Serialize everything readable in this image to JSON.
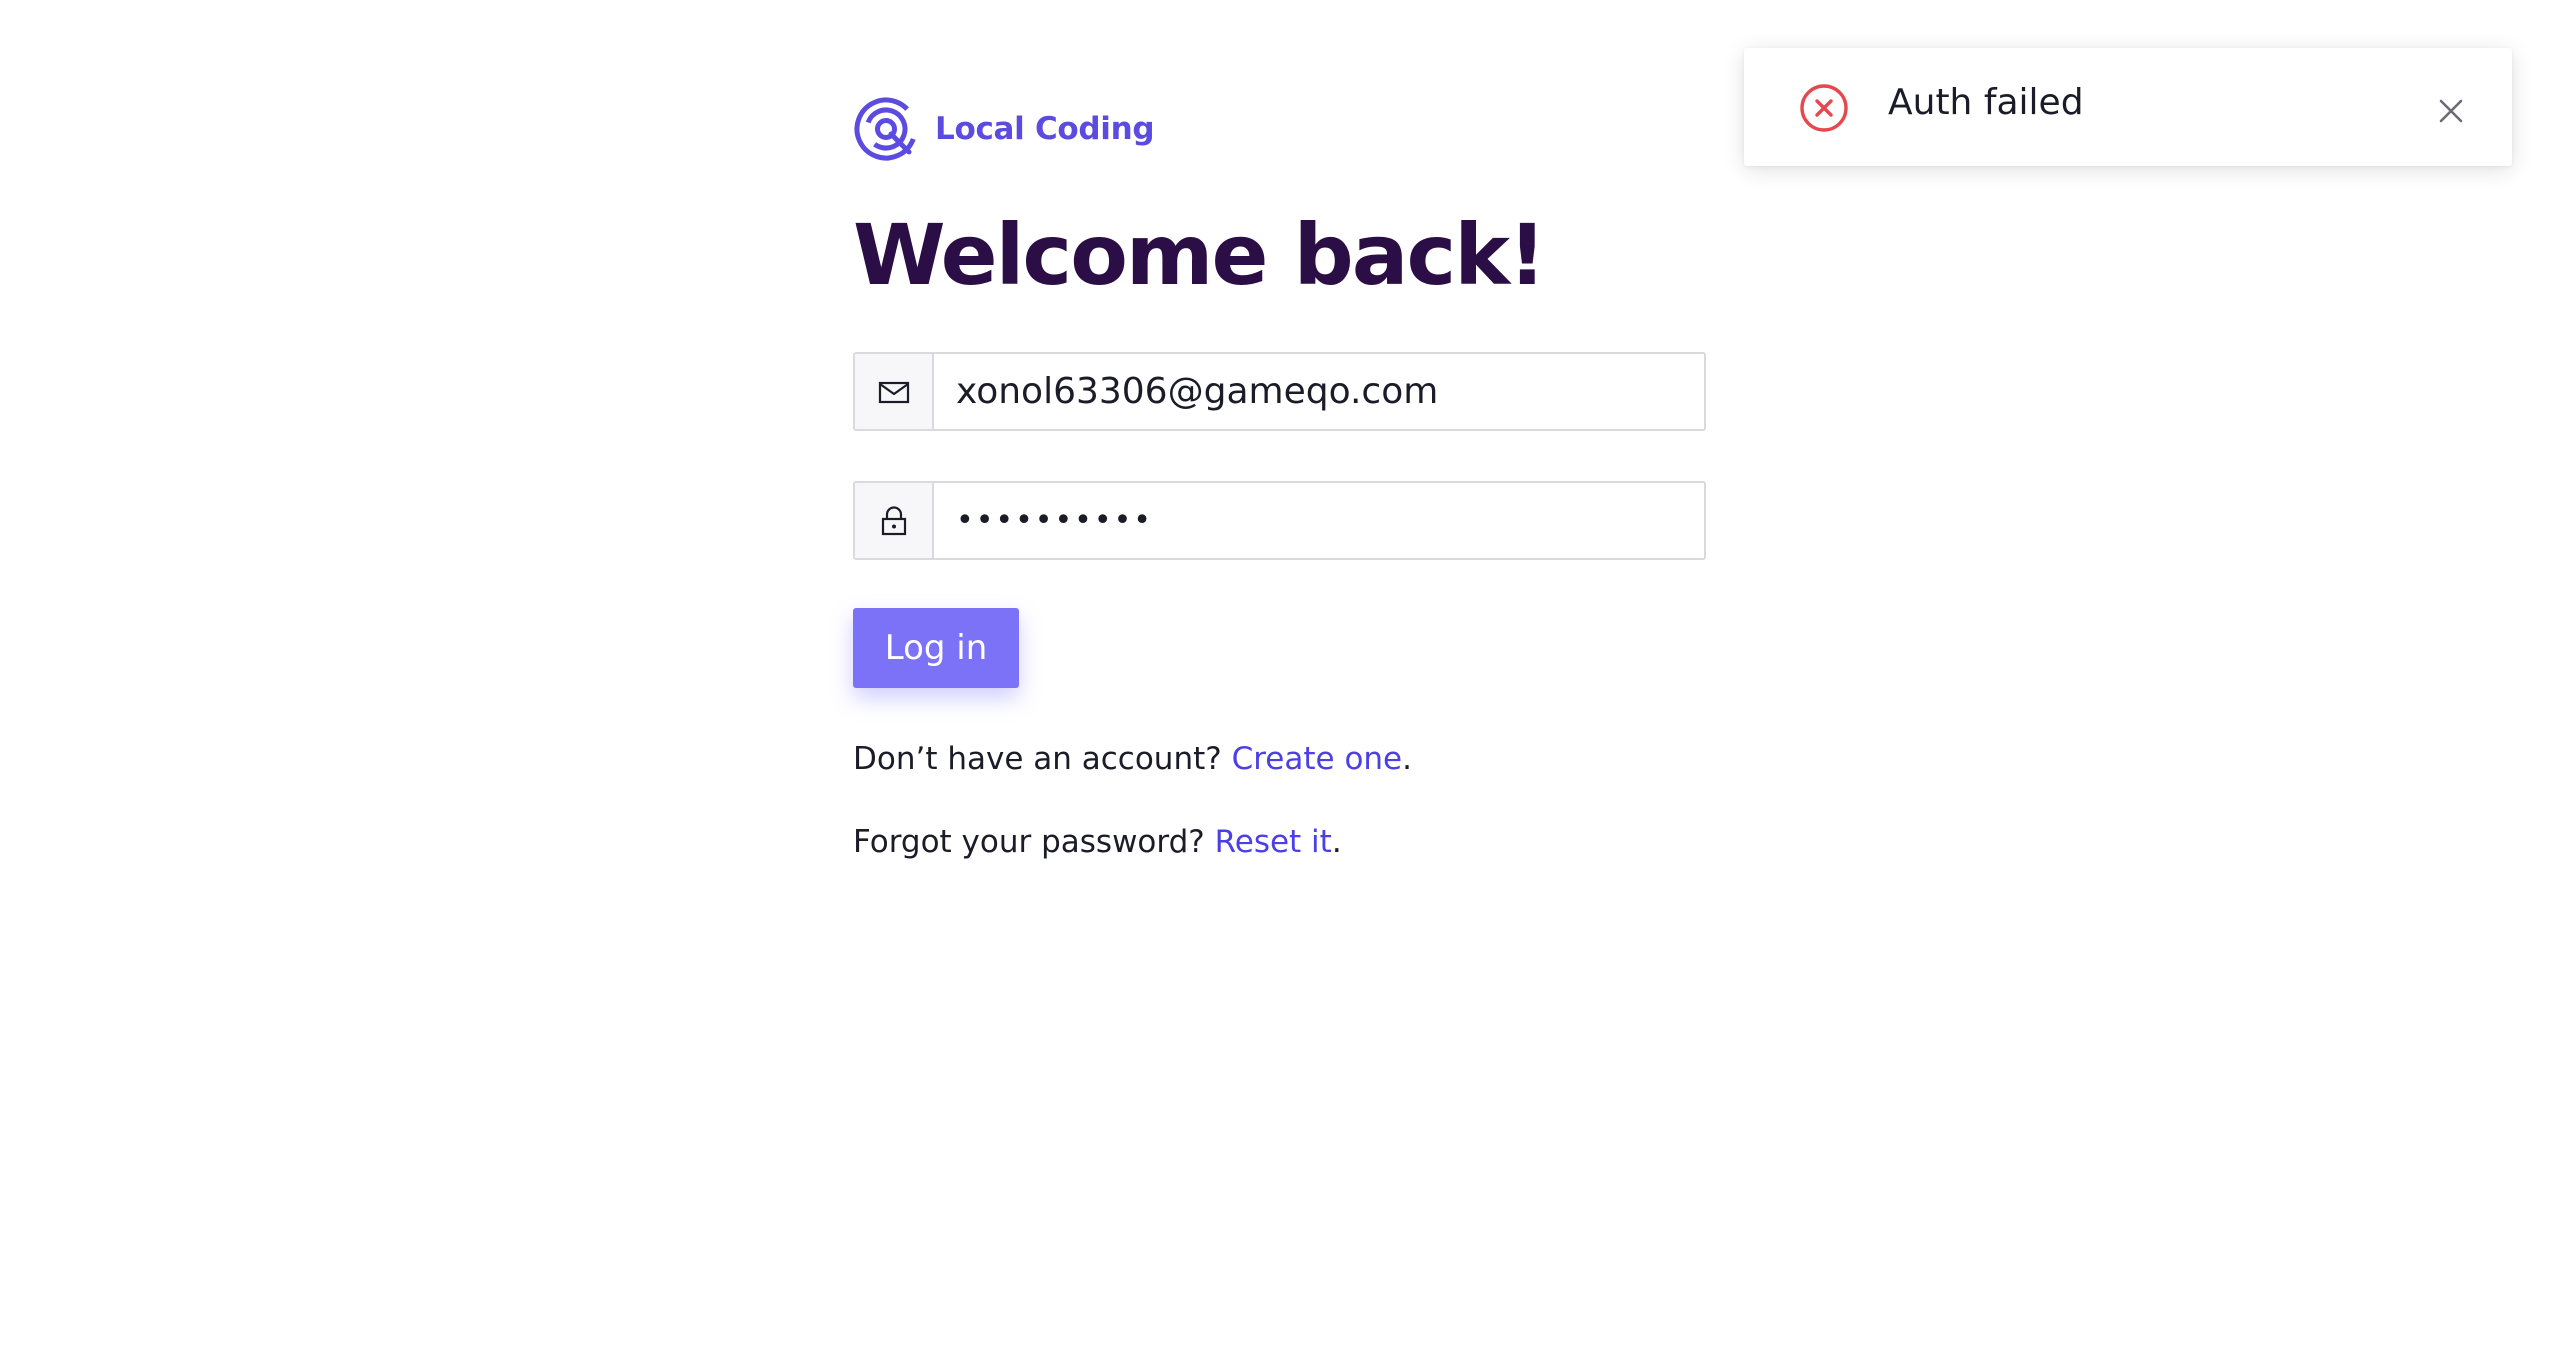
{
  "brand": {
    "name": "Local Coding",
    "color": "#5b4be0"
  },
  "heading": "Welcome back!",
  "form": {
    "email": {
      "icon": "mail-icon",
      "value": "xonol63306@gameqo.com"
    },
    "password": {
      "icon": "lock-icon",
      "value": "••••••••••"
    },
    "login_label": "Log in",
    "login_color": "#7b72f8"
  },
  "links": {
    "create_prompt": "Don’t have an account?",
    "create_label": "Create one",
    "reset_prompt": "Forgot your password?",
    "reset_label": "Reset it",
    "period": ".",
    "link_color": "#4c3fe6"
  },
  "toast": {
    "status": "error",
    "icon": "error-circle-icon",
    "message": "Auth failed",
    "close_icon": "close-icon",
    "status_color": "#e5484d"
  }
}
